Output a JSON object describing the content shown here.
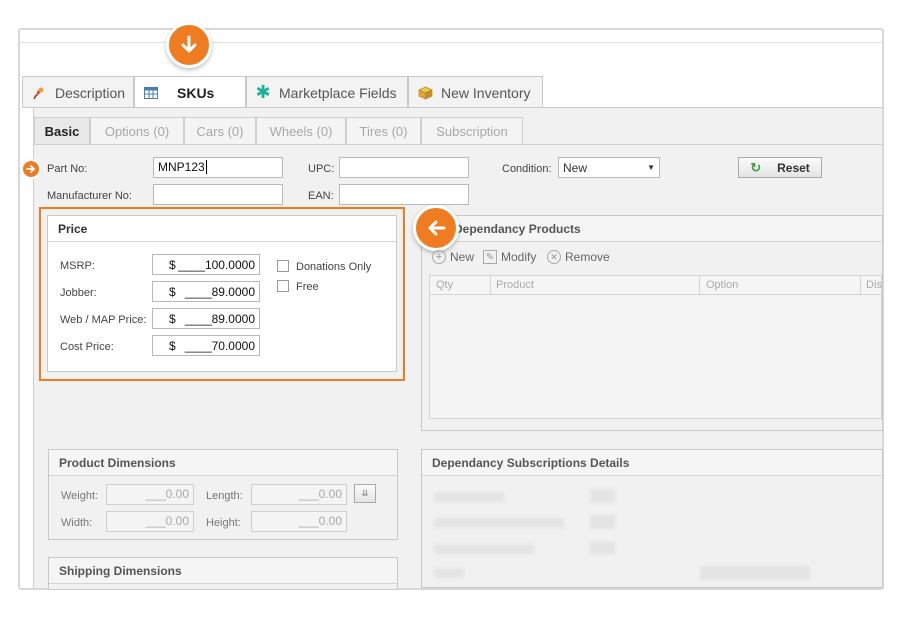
{
  "tabs": [
    {
      "label": "Description",
      "icon": "paint-icon"
    },
    {
      "label": "SKUs",
      "icon": "table-icon"
    },
    {
      "label": "Marketplace Fields",
      "icon": "asterisk-icon"
    },
    {
      "label": "New Inventory",
      "icon": "box-icon"
    }
  ],
  "subtabs": [
    "Basic",
    "Options (0)",
    "Cars (0)",
    "Wheels (0)",
    "Tires (0)",
    "Subscription"
  ],
  "form": {
    "part_no_label": "Part No:",
    "part_no_value": "MNP123",
    "manufacturer_no_label": "Manufacturer No:",
    "manufacturer_no_value": "",
    "upc_label": "UPC:",
    "upc_value": "",
    "ean_label": "EAN:",
    "ean_value": "",
    "condition_label": "Condition:",
    "condition_value": "New",
    "reset_label": "Reset"
  },
  "price": {
    "title": "Price",
    "currency": "$",
    "rows": [
      {
        "label": "MSRP:",
        "value": "____100.0000"
      },
      {
        "label": "Jobber:",
        "value": "____89.0000"
      },
      {
        "label": "Web / MAP Price:",
        "value": "____89.0000"
      },
      {
        "label": "Cost Price:",
        "value": "____70.0000"
      }
    ],
    "donations_only_label": "Donations Only",
    "free_label": "Free"
  },
  "dependancy_products": {
    "title": "Dependancy Products",
    "new_label": "New",
    "modify_label": "Modify",
    "remove_label": "Remove",
    "columns": [
      "Qty",
      "Product",
      "Option",
      "Dis"
    ]
  },
  "product_dimensions": {
    "title": "Product Dimensions",
    "weight_label": "Weight:",
    "weight_value": "___0.00",
    "length_label": "Length:",
    "length_value": "___0.00",
    "width_label": "Width:",
    "width_value": "___0.00",
    "height_label": "Height:",
    "height_value": "___0.00"
  },
  "dependancy_subscriptions": {
    "title": "Dependancy Subscriptions Details"
  },
  "shipping_dimensions": {
    "title": "Shipping Dimensions"
  },
  "colors": {
    "accent": "#f07c22"
  }
}
